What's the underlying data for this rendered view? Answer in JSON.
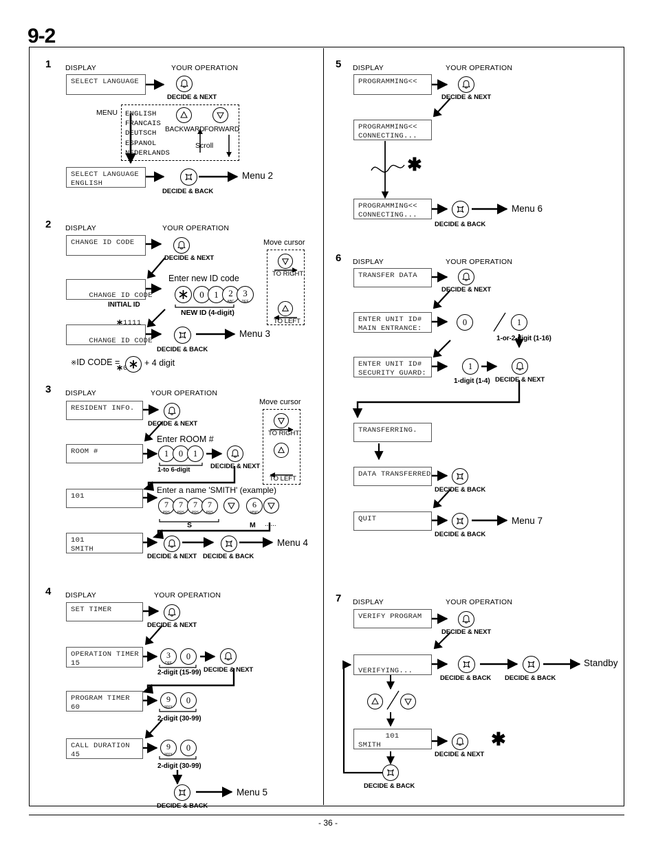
{
  "chapter": "9-2",
  "footer": {
    "page_number": "- 36 -"
  },
  "common": {
    "display_header": "DISPLAY",
    "operation_header": "YOUR OPERATION",
    "decide_next": "DECIDE & NEXT",
    "decide_back": "DECIDE & BACK",
    "move_cursor": "Move cursor",
    "to_right": "TO RIGHT",
    "to_left": "TO LEFT"
  },
  "section1": {
    "number": "1",
    "lcd1": "SELECT LANGUAGE",
    "menu_label": "MENU",
    "menu_items": "ENGLISH\nFRANCAIS\nDEUTSCH\nESPANOL\nNEDERLANDS",
    "backward": "BACKWARD",
    "forward": "FORWARD",
    "scroll": "Scroll",
    "lcd2": "SELECT LANGUAGE\nENGLISH",
    "next_menu": "Menu 2"
  },
  "section2": {
    "number": "2",
    "lcd1": "CHANGE ID CODE",
    "lcd2_line1": "CHANGE ID CODE",
    "lcd2_line2": "1111",
    "initial_id": "INITIAL ID",
    "enter_new": "Enter new ID code",
    "keys": [
      "*",
      "0",
      "1",
      "2",
      "3"
    ],
    "key_sub": [
      "",
      "",
      "",
      "ABC",
      "DEF"
    ],
    "new_id_caption": "NEW ID (4-digit)",
    "lcd3_line1": "CHANGE ID CODE",
    "lcd3_line2": "0123",
    "next_menu": "Menu 3",
    "note": "ID CODE =",
    "note_tail": "+ 4 digit"
  },
  "section3": {
    "number": "3",
    "lcd1": "RESIDENT INFO.",
    "lcd2": "ROOM #",
    "enter_room": "Enter ROOM #",
    "room_keys": [
      "1",
      "0",
      "1"
    ],
    "room_caption": "1-to 6-digit",
    "lcd3": "101",
    "enter_name": "Enter a name 'SMITH' (example)",
    "name_keys": [
      "7",
      "7",
      "7",
      "7",
      "",
      "6",
      ""
    ],
    "name_key_sub": [
      "PRS",
      "PRS",
      "PRS",
      "PRS",
      "",
      "MNO",
      ""
    ],
    "letter_s": "S",
    "letter_m": "M",
    "ellipsis": "......",
    "lcd4": "101\nSMITH",
    "next_menu": "Menu 4"
  },
  "section4": {
    "number": "4",
    "lcd1": "SET TIMER",
    "lcd2": "OPERATION TIMER\n15",
    "keys2": [
      "3",
      "0"
    ],
    "keys2_sub": [
      "DEF",
      ""
    ],
    "caption2": "2-digit (15-99)",
    "lcd3": "PROGRAM TIMER\n60",
    "keys3": [
      "9",
      "0"
    ],
    "keys3_sub": [
      "WXY",
      ""
    ],
    "caption3": "2-digit (30-99)",
    "lcd4": "CALL DURATION\n45",
    "keys4": [
      "9",
      "0"
    ],
    "keys4_sub": [
      "WXY",
      ""
    ],
    "caption4": "2-digit (30-99)",
    "next_menu": "Menu 5"
  },
  "section5": {
    "number": "5",
    "lcd1": "PROGRAMMING<<",
    "lcd2": "PROGRAMMING<<\nCONNECTING...",
    "lcd3": "PROGRAMMING<<\nCONNECTING...",
    "next_menu": "Menu 6"
  },
  "section6": {
    "number": "6",
    "lcd1": "TRANSFER DATA",
    "lcd2": "ENTER UNIT ID#\nMAIN ENTRANCE:",
    "keys2": [
      "0",
      "1"
    ],
    "caption2": "1-or-2-digit (1-16)",
    "lcd3": "ENTER UNIT ID#\nSECURITY GUARD:",
    "keys3": [
      "1"
    ],
    "caption3": "1-digit (1-4)",
    "lcd4": "TRANSFERRING.",
    "lcd5": "DATA TRANSFERRED",
    "lcd6": "QUIT",
    "next_menu": "Menu 7"
  },
  "section7": {
    "number": "7",
    "lcd1": "VERIFY PROGRAM",
    "lcd2": "\nVERIFYING...",
    "standby": "Standby",
    "lcd3": "      101\nSMITH",
    "next_menu": ""
  }
}
